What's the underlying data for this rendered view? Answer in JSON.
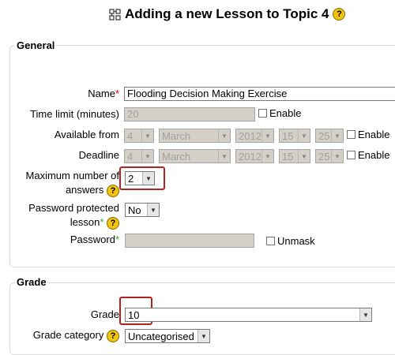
{
  "header": {
    "title": "Adding a new Lesson to Topic 4"
  },
  "general": {
    "legend": "General",
    "name_label": "Name",
    "name_value": "Flooding Decision Making Exercise",
    "time_limit_label": "Time limit (minutes)",
    "time_limit_value": "20",
    "enable_label": "Enable",
    "available_from_label": "Available from",
    "deadline_label": "Deadline",
    "date": {
      "day": "4",
      "month": "March",
      "year": "2012",
      "hour": "15",
      "minute": "25"
    },
    "max_answers_label_1": "Maximum number of",
    "max_answers_label_2": "answers",
    "max_answers_value": "2",
    "password_protected_label_1": "Password protected",
    "password_protected_label_2": "lesson",
    "password_protected_value": "No",
    "password_label": "Password",
    "unmask_label": "Unmask"
  },
  "grade": {
    "legend": "Grade",
    "grade_label": "Grade",
    "grade_value": "10",
    "category_label": "Grade category",
    "category_value": "Uncategorised"
  },
  "help_glyph": "?",
  "required_glyph": "*",
  "colors": {
    "required": "#cc0000",
    "advanced": "#2eaa2e",
    "highlight": "#b22222"
  }
}
